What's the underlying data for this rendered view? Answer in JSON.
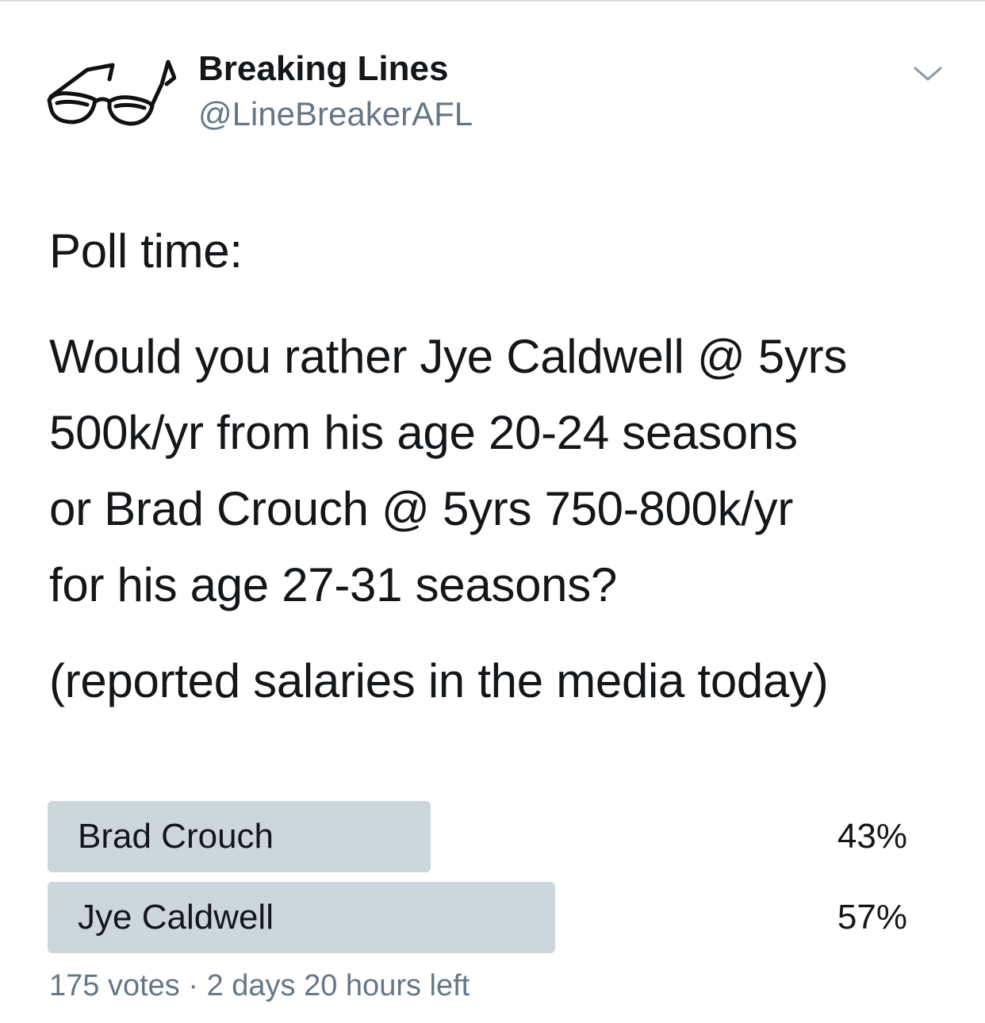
{
  "account": {
    "display_name": "Breaking Lines",
    "handle": "@LineBreakerAFL",
    "avatar_icon": "glasses-icon"
  },
  "menu_icon": "chevron-down-icon",
  "tweet": {
    "intro": "Poll time:",
    "question_lines": [
      "Would you rather Jye Caldwell @ 5yrs",
      "500k/yr from his age 20-24 seasons",
      "or Brad Crouch @ 5yrs 750-800k/yr",
      "for his age 27-31 seasons?"
    ],
    "note": "(reported salaries in the media today)"
  },
  "poll": {
    "options": [
      {
        "label": "Brad Crouch",
        "percent_text": "43%",
        "percent": 43
      },
      {
        "label": "Jye Caldwell",
        "percent_text": "57%",
        "percent": 57
      }
    ],
    "votes": "175 votes",
    "separator": "·",
    "time_left": "2 days 20 hours left"
  },
  "colors": {
    "text": "#14171a",
    "secondary_text": "#657786",
    "poll_bar": "#ccd6dd"
  }
}
